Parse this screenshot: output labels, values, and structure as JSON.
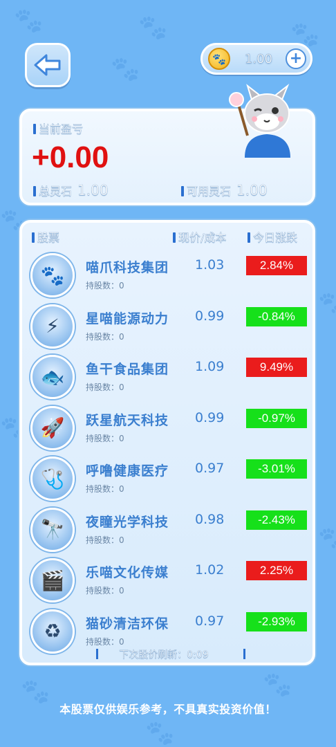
{
  "topbar": {
    "coin_value": "1.00",
    "add_symbol": "+"
  },
  "profit": {
    "title": "当前盈亏",
    "value": "+0.00",
    "total_label": "总灵石",
    "total_value": "1.00",
    "avail_label": "可用灵石",
    "avail_value": "1.00"
  },
  "list": {
    "headers": {
      "name": "股票",
      "price": "现价/成本",
      "change": "今日涨跌"
    },
    "rows": [
      {
        "name": "喵爪科技集团",
        "price": "1.03",
        "change": "2.84%",
        "hold": "持股数：0",
        "up": true,
        "icon": "🐾"
      },
      {
        "name": "星喵能源动力",
        "price": "0.99",
        "change": "-0.84%",
        "hold": "持股数：0",
        "up": false,
        "icon": "⚡"
      },
      {
        "name": "鱼干食品集团",
        "price": "1.09",
        "change": "9.49%",
        "hold": "持股数：0",
        "up": true,
        "icon": "🐟"
      },
      {
        "name": "跃星航天科技",
        "price": "0.99",
        "change": "-0.97%",
        "hold": "持股数：0",
        "up": false,
        "icon": "🚀"
      },
      {
        "name": "呼噜健康医疗",
        "price": "0.97",
        "change": "-3.01%",
        "hold": "持股数：0",
        "up": false,
        "icon": "🩺"
      },
      {
        "name": "夜瞳光学科技",
        "price": "0.98",
        "change": "-2.43%",
        "hold": "持股数：0",
        "up": false,
        "icon": "🔭"
      },
      {
        "name": "乐喵文化传媒",
        "price": "1.02",
        "change": "2.25%",
        "hold": "持股数：0",
        "up": true,
        "icon": "🎬"
      },
      {
        "name": "猫砂清洁环保",
        "price": "0.97",
        "change": "-2.93%",
        "hold": "持股数：0",
        "up": false,
        "icon": "♻"
      }
    ],
    "refresh_label": "下次股价刷新：",
    "refresh_time": "0:09"
  },
  "colors": {
    "up": "#ea1c1c",
    "down": "#16e01a"
  },
  "disclaimer": "本股票仅供娱乐参考，不具真实投资价值！"
}
